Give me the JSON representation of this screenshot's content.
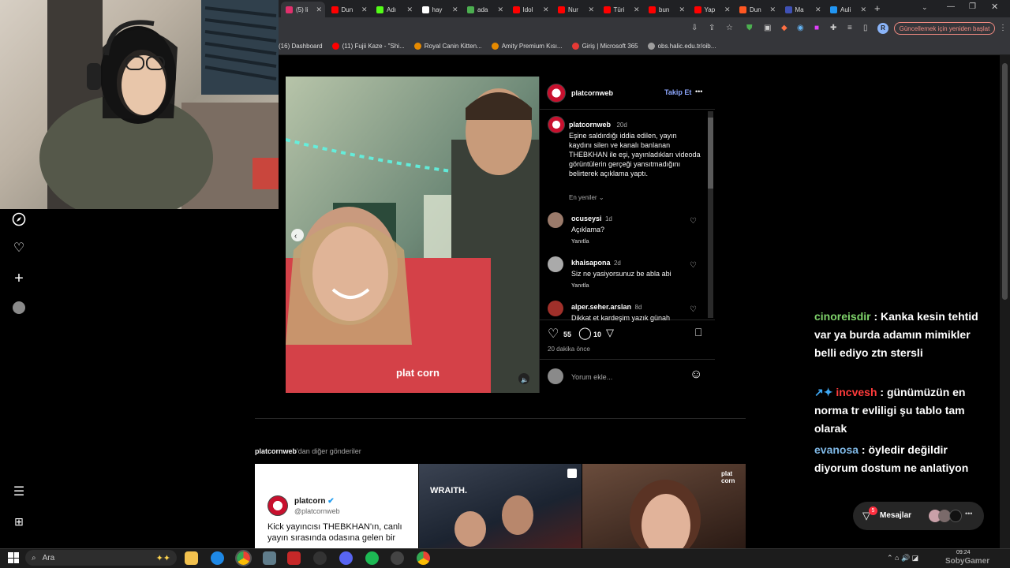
{
  "browser": {
    "tabs": [
      {
        "label": "(5) li",
        "color": "#e1306c"
      },
      {
        "label": "Dun",
        "color": "#ff0000"
      },
      {
        "label": "Adı",
        "color": "#53fc18"
      },
      {
        "label": "hay",
        "color": "#ffffff"
      },
      {
        "label": "ada",
        "color": "#4caf50"
      },
      {
        "label": "Idol",
        "color": "#ff0000"
      },
      {
        "label": "Nur",
        "color": "#ff0000"
      },
      {
        "label": "Türi",
        "color": "#ff0000"
      },
      {
        "label": "bun",
        "color": "#ff0000"
      },
      {
        "label": "Yap",
        "color": "#ff0000"
      },
      {
        "label": "Dun",
        "color": "#ff5722"
      },
      {
        "label": "Ma",
        "color": "#3f51b5"
      },
      {
        "label": "Auli",
        "color": "#2196f3"
      }
    ],
    "new_tab": "+",
    "update_button": "Güncellemek için yeniden başlat",
    "profile_initial": "R",
    "bookmarks": [
      {
        "label": "(16) Dashboard",
        "color": "#888888"
      },
      {
        "label": "(11) Fujii Kaze - \"Shi...",
        "color": "#ff0000"
      },
      {
        "label": "Royal Canin Kitten...",
        "color": "#e68a00"
      },
      {
        "label": "Amity Premium Kısı...",
        "color": "#e68a00"
      },
      {
        "label": "Giriş | Microsoft 365",
        "color": "#e53935"
      },
      {
        "label": "obs.halic.edu.tr/oib...",
        "color": "#9e9e9e"
      }
    ]
  },
  "post": {
    "username": "platcornweb",
    "follow": "Takip Et",
    "more": "•••",
    "caption_user": "platcornweb",
    "caption_age": "20d",
    "caption": "Eşine saldırdığı iddia edilen, yayın kaydını silen ve kanalı banlanan THEBKHAN ile eşi, yayınladıkları videoda görüntülerin gerçeği yansıtmadığını belirterek açıklama yaptı.",
    "sort": "En yeniler",
    "comments": [
      {
        "user": "ocuseysi",
        "age": "1d",
        "text": "Açıklama?",
        "reply": "Yanıtla"
      },
      {
        "user": "khaisapona",
        "age": "2d",
        "text": "Siz ne yasiyorsunuz be abla abi",
        "reply": "Yanıtla"
      },
      {
        "user": "alper.seher.arslan",
        "age": "8d",
        "text": "Dikkat et kardeşim yazık günah",
        "reply": ""
      }
    ],
    "likes": "55",
    "comments_count": "10",
    "time_ago": "20 dakika önce",
    "comment_placeholder": "Yorum ekle...",
    "watermark": "plat corn"
  },
  "more_posts": {
    "heading_user": "platcornweb",
    "heading_rest": "'dan diğer gönderiler",
    "card1": {
      "name": "platcorn",
      "handle": "@platcornweb",
      "text": "Kick yayıncısı THEBKHAN'ın, canlı yayın sırasında odasına gelen bir"
    },
    "card2_label": "WRAITH."
  },
  "chat": [
    {
      "user": "cinoreisdir",
      "user_color": "#7fd36b",
      "badges": "",
      "message": " : Kanka kesin tehtid var ya burda adamın mimikler belli ediyo ztn stersli"
    },
    {
      "user": "incvesh",
      "user_color": "#ff3b3b",
      "badges": "↗✦ ",
      "message": " : günümüzün en norma tr evliligi şu tablo tam olarak"
    },
    {
      "user": "evanosa",
      "user_color": "#7fb8e6",
      "badges": "",
      "message": " : öyledir değildir diyorum dostum ne anlatiyon"
    }
  ],
  "messages": {
    "label": "Mesajlar",
    "badge": "5"
  },
  "taskbar": {
    "search": "Ara",
    "time": "09:24",
    "watermark": "SobyGamer"
  }
}
